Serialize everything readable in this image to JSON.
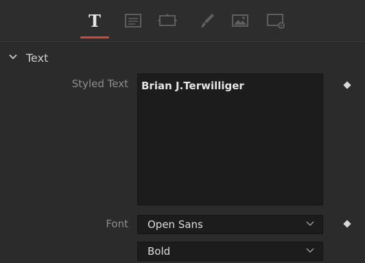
{
  "tabs": [
    {
      "name": "text",
      "icon": "text-T-icon",
      "active": true
    },
    {
      "name": "layout",
      "icon": "layout-icon",
      "active": false
    },
    {
      "name": "transform",
      "icon": "transform-icon",
      "active": false
    },
    {
      "name": "shading",
      "icon": "brush-icon",
      "active": false
    },
    {
      "name": "image",
      "icon": "image-icon",
      "active": false
    },
    {
      "name": "settings",
      "icon": "settings-icon",
      "active": false
    }
  ],
  "tab_glyph": "T",
  "section": {
    "title": "Text",
    "expanded": true
  },
  "styled_text": {
    "label": "Styled Text",
    "value": "Brian J.Terwilliger"
  },
  "font": {
    "label": "Font",
    "family": "Open Sans",
    "style": "Bold"
  },
  "colors": {
    "accent": "#d9433a",
    "panel": "#2b2b2b",
    "field": "#1c1c1c"
  }
}
